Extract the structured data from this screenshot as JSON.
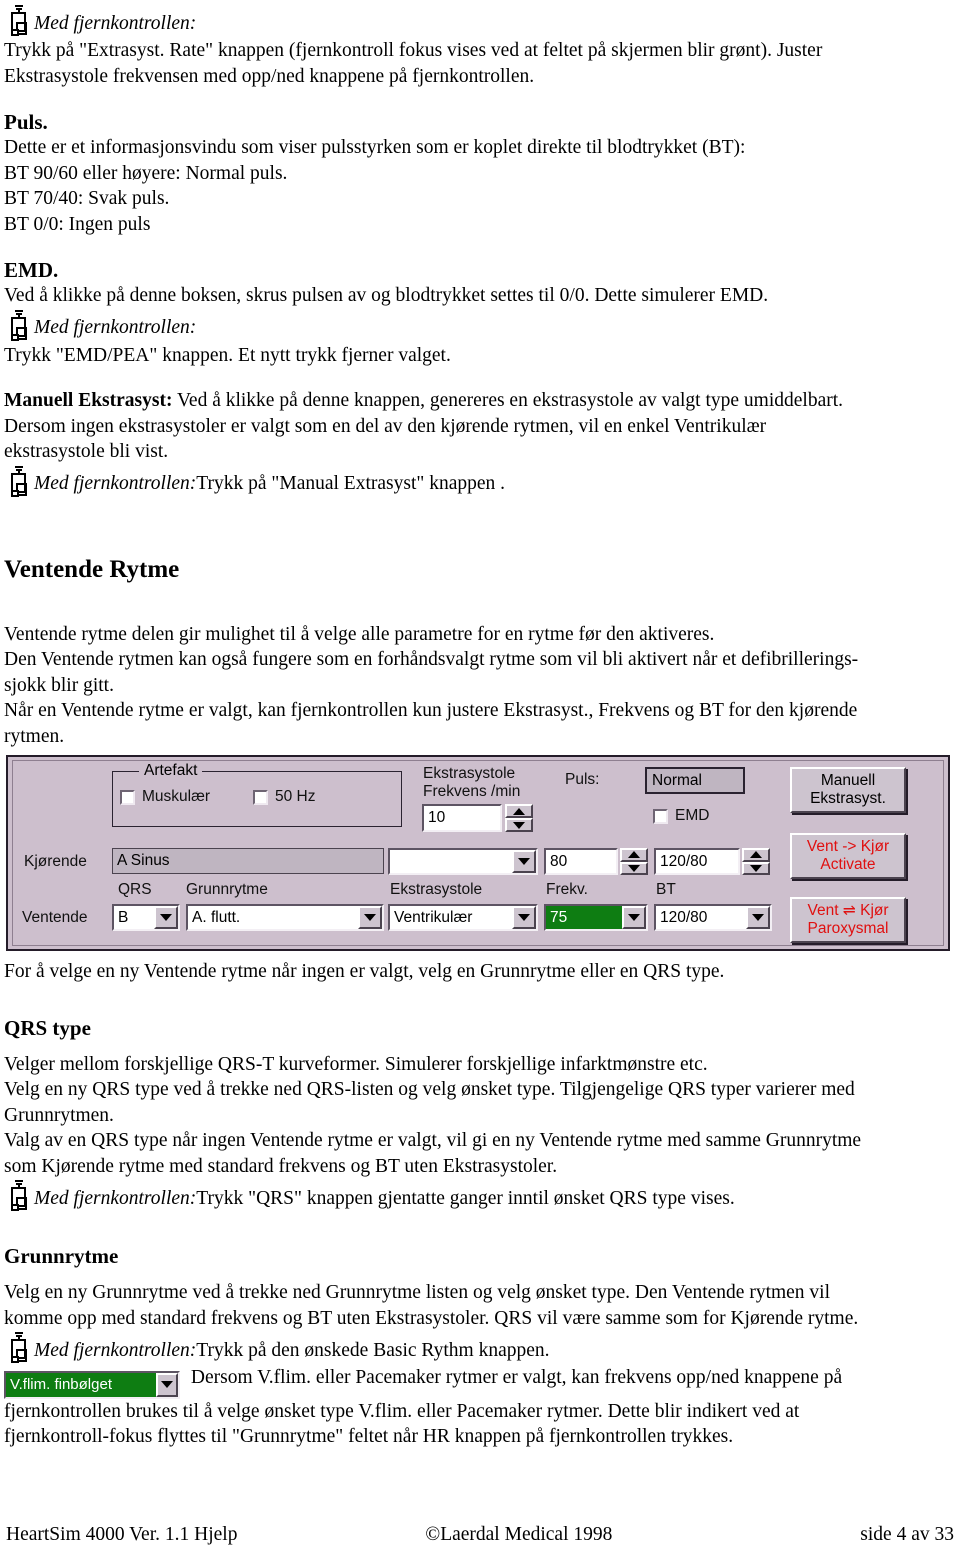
{
  "document": {
    "title": "HeartSim 4000 Ver. 1.1 Hjelp"
  },
  "sections": {
    "remote_top": {
      "icon": "remote-control-icon",
      "label": "Med fjernkontrollen:",
      "line1": "Trykk på \"Extrasyst. Rate\" knappen (fjernkontroll fokus vises ved at feltet på skjermen blir grønt). Juster",
      "line2": "Ekstrasystole frekvensen med opp/ned knappene på fjernkontrollen."
    },
    "puls": {
      "heading": "Puls.",
      "line1": "Dette er et informasjonsvindu som viser pulsstyrken som er koplet direkte til blodtrykket (BT):",
      "line2": "BT  90/60 eller høyere: Normal puls.",
      "line3": "BT  70/40: Svak puls.",
      "line4": "BT 0/0: Ingen puls"
    },
    "emd": {
      "heading": "EMD.",
      "line1": "Ved å klikke på denne boksen, skrus pulsen av og blodtrykket settes til  0/0. Dette simulerer EMD.",
      "remote_label": "Med fjernkontrollen:",
      "line2": "Trykk \"EMD/PEA\" knappen. Et nytt trykk fjerner valget."
    },
    "manuell": {
      "lead_bold": "Manuell Ekstrasyst:",
      "lead_rest": " Ved å klikke på denne knappen, genereres en ekstrasystole av valgt type umiddelbart.",
      "line2": "Dersom ingen ekstrasystoler er valgt som en del av den kjørende rytmen, vil en enkel Ventrikulær",
      "line3": "ekstrasystole bli vist.",
      "remote_label": "Med fjernkontrollen:",
      "remote_rest": " Trykk på \"Manual Extrasyst\" knappen ."
    },
    "ventende": {
      "heading": "Ventende Rytme",
      "line1": "Ventende rytme delen gir mulighet til å velge alle parametre for en rytme før den aktiveres.",
      "line2": "Den Ventende rytmen kan også fungere som en forhåndsvalgt rytme som vil bli aktivert når et defibrillerings-",
      "line3": "sjokk blir gitt.",
      "line4": "Når en Ventende rytme er valgt, kan fjernkontrollen kun justere  Ekstrasyst., Frekvens og BT for den kjørende",
      "line5": "rytmen.",
      "after_panel": "For å velge en ny Ventende rytme når ingen er valgt, velg en Grunnrytme eller en QRS type."
    },
    "qrs": {
      "heading": "QRS type",
      "line1": "Velger mellom forskjellige  QRS-T kurveformer. Simulerer forskjellige infarktmønstre etc.",
      "line2": "Velg en ny QRS type ved å trekke ned QRS-listen og velg ønsket type. Tilgjengelige QRS typer varierer med",
      "line3": "Grunnrytmen.",
      "line4": "Valg av en QRS type når ingen Ventende rytme er valgt, vil gi en ny Ventende rytme med samme Grunnrytme",
      "line5": "som Kjørende rytme med standard frekvens og BT uten Ekstrasystoler.",
      "remote_label": "Med fjernkontrollen:",
      "remote_rest": " Trykk \"QRS\" knappen gjentatte ganger inntil ønsket QRS type vises."
    },
    "grunnrytme": {
      "heading": "Grunnrytme",
      "line1": "Velg en ny Grunnrytme ved å trekke ned Grunnrytme listen og velg ønsket type. Den Ventende rytmen vil",
      "line2": "komme opp med standard frekvens og BT uten Ekstrasystoler. QRS vil være samme som for Kjørende rytme.",
      "remote_label": "Med fjernkontrollen:",
      "remote_rest": " Trykk på den ønskede Basic Rythm knappen.",
      "combo_value": "V.flim. finbølget",
      "line3": " Dersom V.flim. eller Pacemaker rytmer er valgt, kan frekvens opp/ned knappene på",
      "line4": "fjernkontrollen brukes til å velge ønsket type V.flim. eller Pacemaker rytmer. Dette blir indikert ved at",
      "line5": "fjernkontroll-fokus flyttes til \"Grunnrytme\" feltet når HR knappen på fjernkontrollen trykkes."
    }
  },
  "sim_panel": {
    "artefakt": {
      "title": "Artefakt",
      "muskulaer_label": "Muskulær",
      "muskulaer_checked": false,
      "hz50_label": "50 Hz",
      "hz50_checked": false
    },
    "ekstrasystole_frekvens": {
      "label_line1": "Ekstrasystole",
      "label_line2": "Frekvens /min",
      "value": "10"
    },
    "puls": {
      "label": "Puls:",
      "value": "Normal"
    },
    "emd": {
      "label": "EMD",
      "checked": false
    },
    "rows": {
      "kjorende_label": "Kjørende",
      "kjorende_rhythm": "A          Sinus",
      "kjorende_ekstrasystole": "",
      "kjorende_frekv": "80",
      "kjorende_bt": "120/80",
      "ventende_label": "Ventende",
      "ventende_qrs": "B",
      "ventende_grunnrytme": "A. flutt.",
      "ventende_ekstrasystole": "Ventrikulær",
      "ventende_frekv": "75",
      "ventende_bt": "120/80"
    },
    "col_headers": {
      "qrs": "QRS",
      "grunnrytme": "Grunnrytme",
      "ekstrasystole": "Ekstrasystole",
      "frekv": "Frekv.",
      "bt": "BT"
    },
    "buttons": {
      "manuell_line1": "Manuell",
      "manuell_line2": "Ekstrasyst.",
      "activate_line1": "Vent -> Kjør",
      "activate_line2": "Activate",
      "paroxysmal_line1": "Vent ⇌ Kjør",
      "paroxysmal_line2": "Paroxysmal"
    },
    "colors": {
      "panel_bg": "#cdbfcd",
      "button_face": "#cdc4cf",
      "red_text": "#e01010",
      "green_field": "#0e7d12"
    }
  },
  "footer": {
    "left": "HeartSim 4000 Ver.  1.1 Hjelp",
    "middle": "©Laerdal Medical  1998",
    "right": "side 4 av 33"
  }
}
